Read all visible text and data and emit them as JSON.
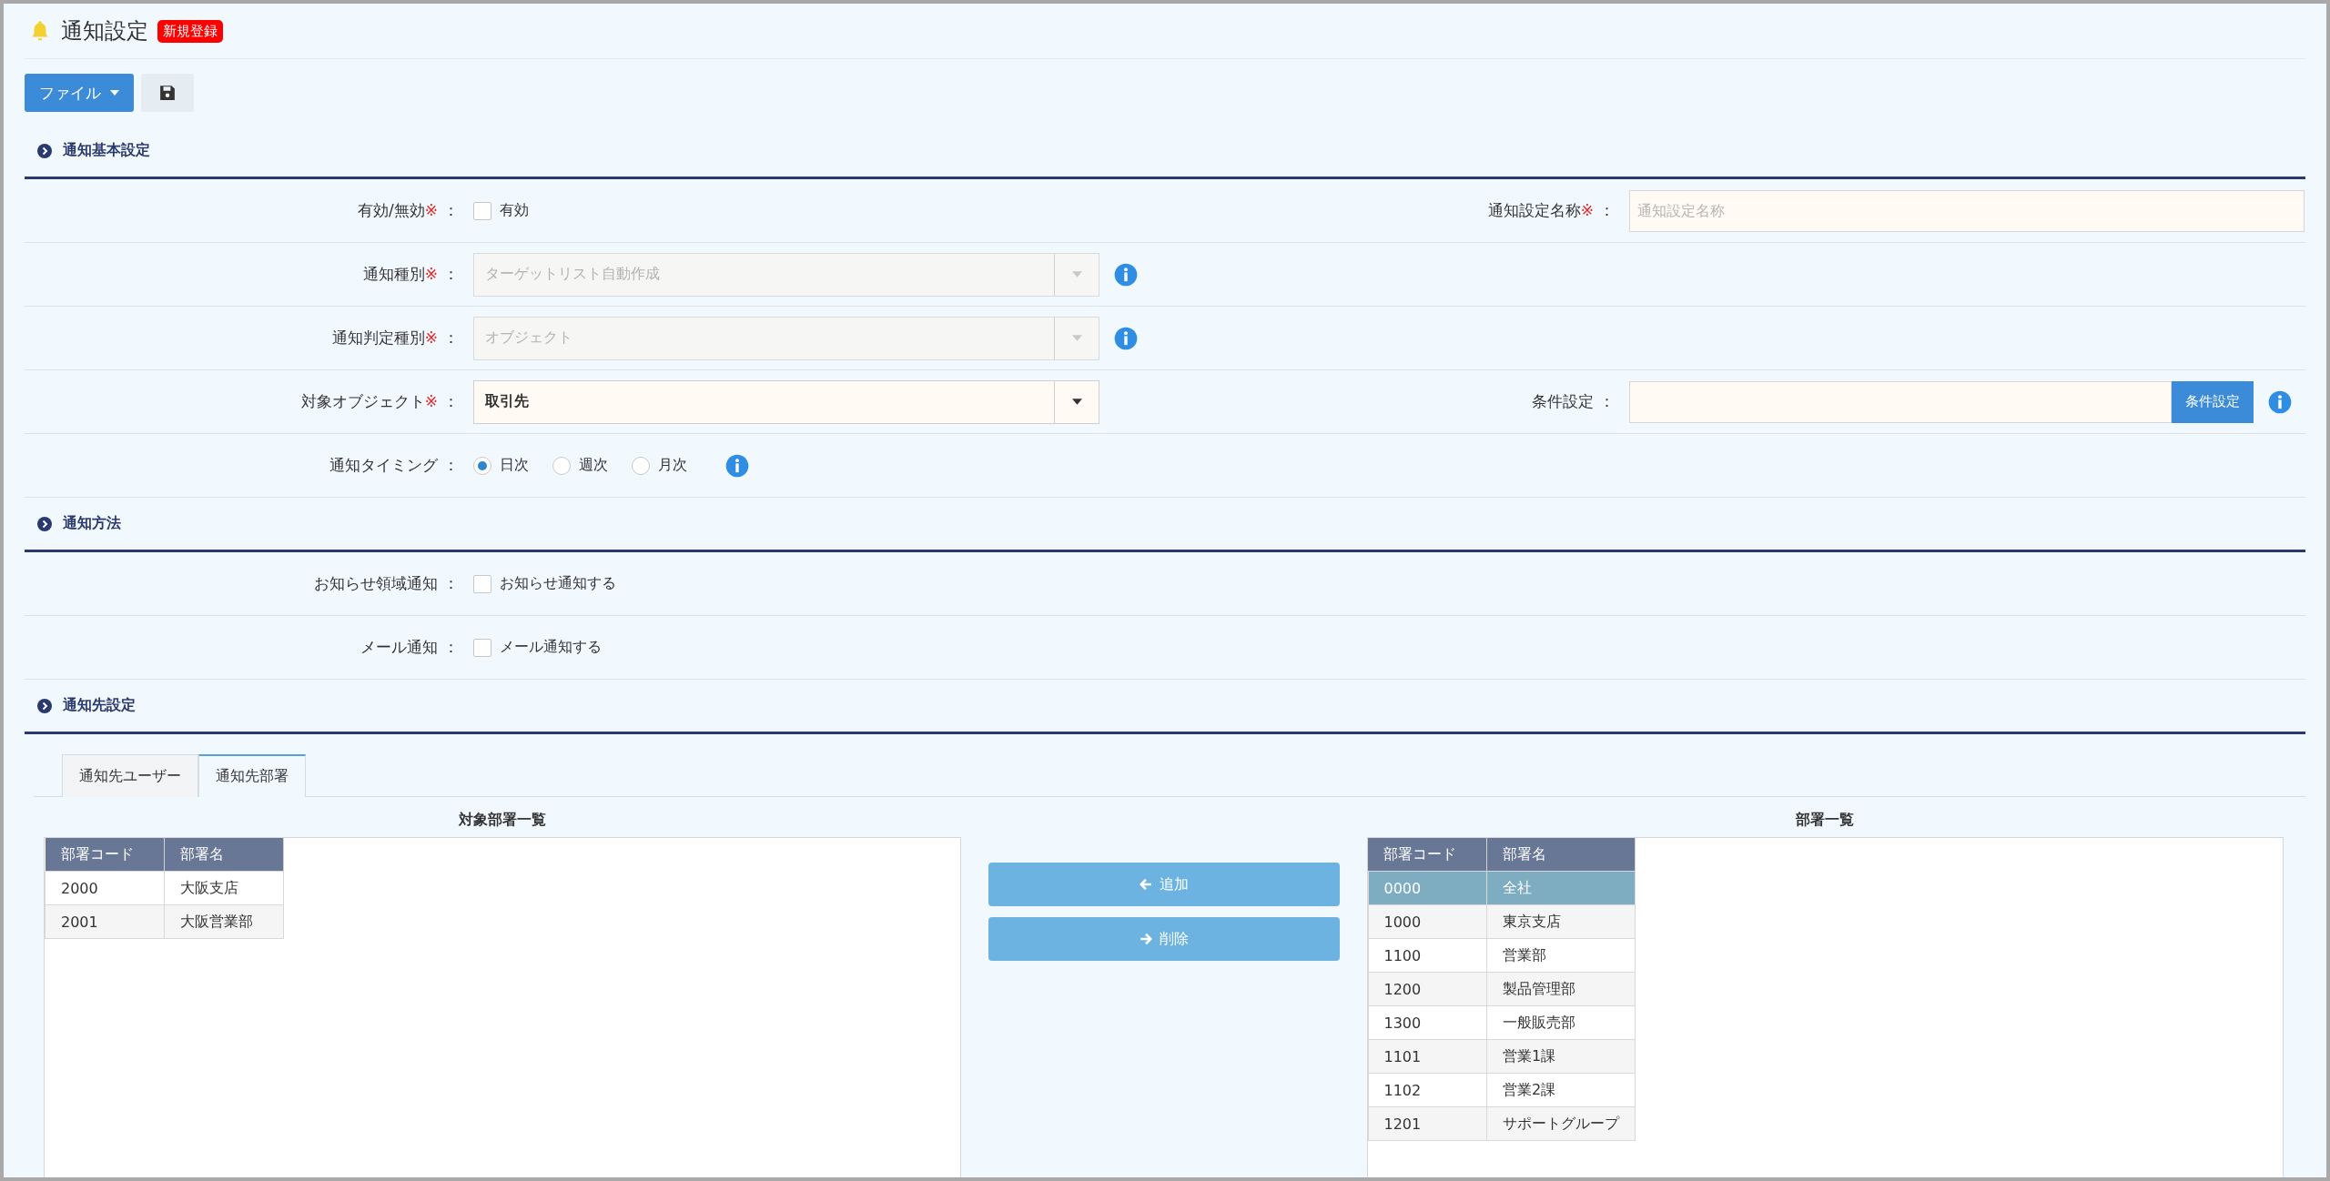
{
  "header": {
    "title": "通知設定",
    "badge": "新規登録"
  },
  "toolbar": {
    "file_button": "ファイル"
  },
  "sections": [
    {
      "title": "通知基本設定",
      "rows": [
        {
          "fields": [
            {
              "kind": "checkbox",
              "label": "有効/無効",
              "mark": "※",
              "separator": "：",
              "option": "有効",
              "checked": false
            },
            {
              "kind": "text",
              "label": "通知設定名称",
              "mark": "※",
              "separator": "：",
              "placeholder": "通知設定名称"
            }
          ]
        },
        {
          "fields": [
            {
              "kind": "select",
              "label": "通知種別",
              "mark": "※",
              "separator": "：",
              "value": "ターゲットリスト自動作成",
              "disabled": true,
              "info": true
            }
          ]
        },
        {
          "fields": [
            {
              "kind": "select",
              "label": "通知判定種別",
              "mark": "※",
              "separator": "：",
              "value": "オブジェクト",
              "disabled": true,
              "info": true
            }
          ]
        },
        {
          "fields": [
            {
              "kind": "select",
              "label": "対象オブジェクト",
              "mark": "※",
              "separator": "：",
              "value": "取引先",
              "disabled": false
            },
            {
              "kind": "action",
              "label": "条件設定",
              "separator": "：",
              "button": "条件設定",
              "info": true
            }
          ]
        },
        {
          "fields": [
            {
              "kind": "radio",
              "label": "通知タイミング",
              "separator": "：",
              "info": true,
              "options": [
                {
                  "label": "日次",
                  "selected": true
                },
                {
                  "label": "週次",
                  "selected": false
                },
                {
                  "label": "月次",
                  "selected": false
                }
              ]
            }
          ]
        }
      ]
    },
    {
      "title": "通知方法",
      "rows": [
        {
          "fields": [
            {
              "kind": "checkbox",
              "label": "お知らせ領域通知",
              "separator": "：",
              "option": "お知らせ通知する",
              "checked": false
            }
          ]
        },
        {
          "fields": [
            {
              "kind": "checkbox",
              "label": "メール通知",
              "separator": "：",
              "option": "メール通知する",
              "checked": false
            }
          ]
        }
      ]
    },
    {
      "title": "通知先設定"
    }
  ],
  "tabs": [
    {
      "label": "通知先ユーザー",
      "selected": false
    },
    {
      "label": "通知先部署",
      "selected": true
    }
  ],
  "target_list": {
    "title": "対象部署一覧",
    "columns": [
      "部署コード",
      "部署名"
    ],
    "rows": [
      {
        "cells": [
          "2000",
          "大阪支店"
        ],
        "selected": false
      },
      {
        "cells": [
          "2001",
          "大阪営業部"
        ],
        "selected": false
      }
    ]
  },
  "move_buttons": [
    {
      "kind": "add",
      "label": "追加"
    },
    {
      "kind": "remove",
      "label": "削除"
    }
  ],
  "department_list": {
    "title": "部署一覧",
    "columns": [
      "部署コード",
      "部署名"
    ],
    "rows": [
      {
        "cells": [
          "0000",
          "全社"
        ],
        "selected": true
      },
      {
        "cells": [
          "1000",
          "東京支店"
        ],
        "selected": false
      },
      {
        "cells": [
          "1100",
          "営業部"
        ],
        "selected": false
      },
      {
        "cells": [
          "1200",
          "製品管理部"
        ],
        "selected": false
      },
      {
        "cells": [
          "1300",
          "一般販売部"
        ],
        "selected": false
      },
      {
        "cells": [
          "1101",
          "営業1課"
        ],
        "selected": false
      },
      {
        "cells": [
          "1102",
          "営業2課"
        ],
        "selected": false
      },
      {
        "cells": [
          "1201",
          "サポートグループ"
        ],
        "selected": false
      }
    ]
  }
}
